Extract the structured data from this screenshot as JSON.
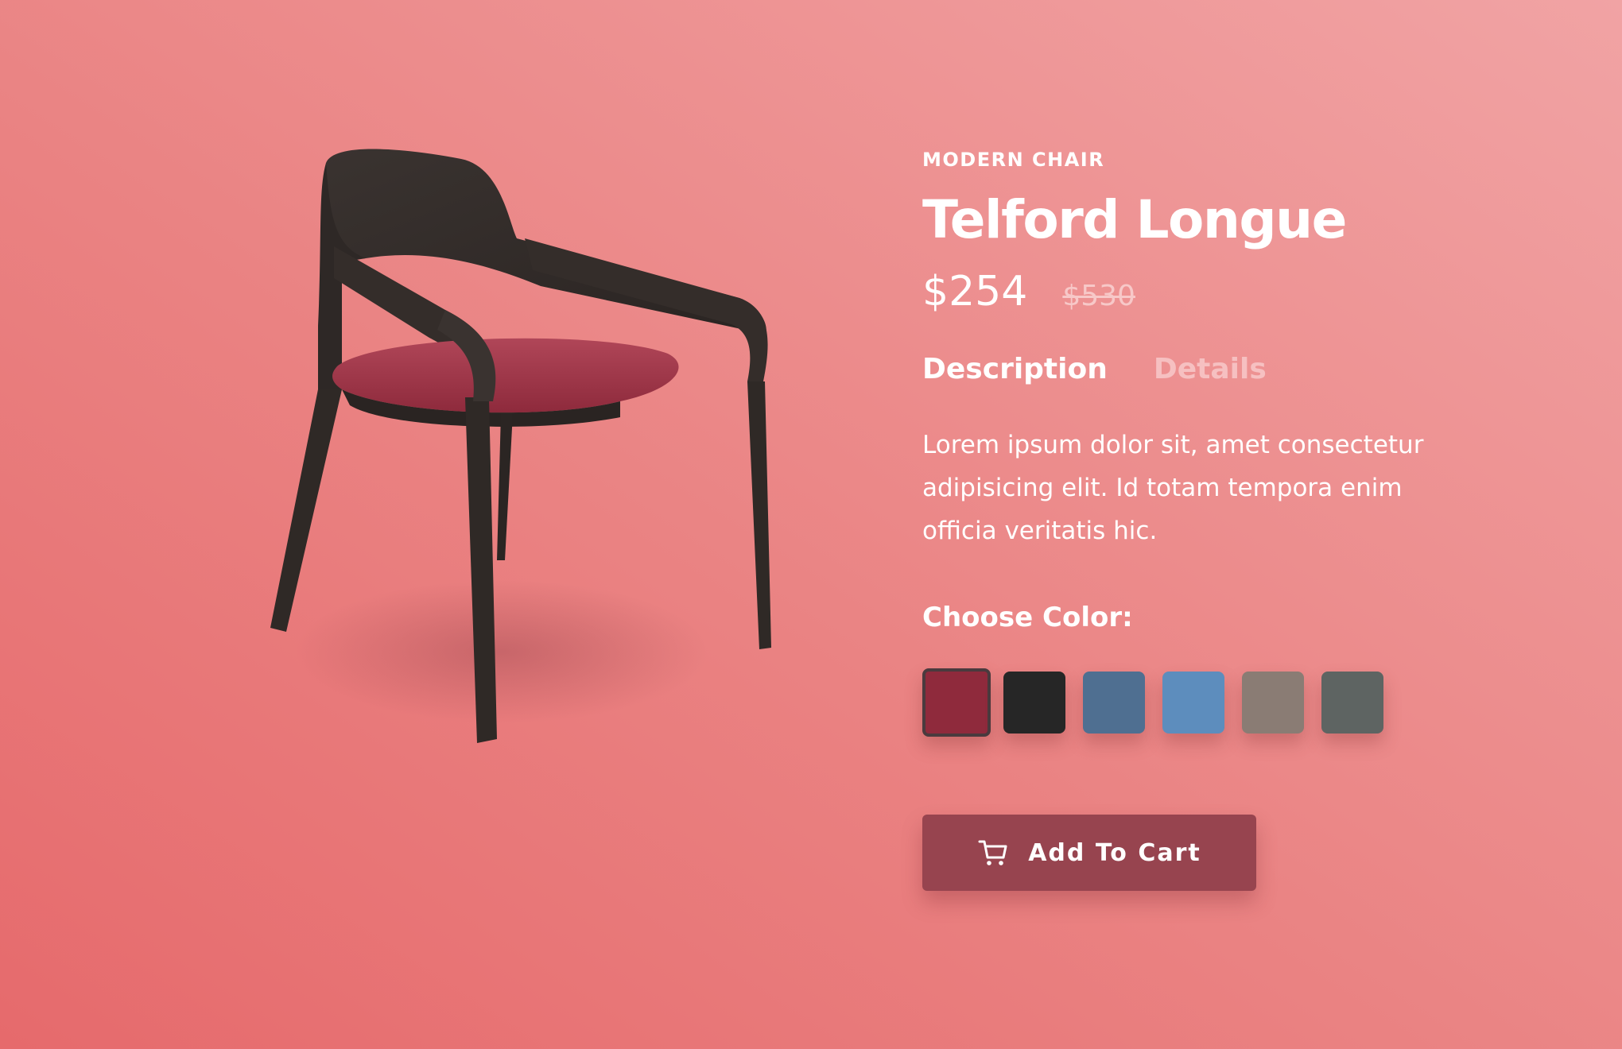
{
  "product": {
    "category": "MODERN CHAIR",
    "title": "Telford Longue",
    "price": "$254",
    "old_price": "$530"
  },
  "tabs": {
    "description_label": "Description",
    "details_label": "Details"
  },
  "description_text": "Lorem ipsum dolor sit, amet consectetur adipisicing elit. Id totam tempora enim officia veritatis hic.",
  "color_picker": {
    "label": "Choose Color:",
    "swatches": [
      {
        "color": "#8f2a3c",
        "selected": true
      },
      {
        "color": "#262626",
        "selected": false
      },
      {
        "color": "#4f6f91",
        "selected": false
      },
      {
        "color": "#5d8dbd",
        "selected": false
      },
      {
        "color": "#8a7c74",
        "selected": false
      },
      {
        "color": "#5e6462",
        "selected": false
      }
    ]
  },
  "cart_button": {
    "label": "Add To Cart",
    "icon": "cart-icon"
  },
  "theme": {
    "background_start": "#e66a6c",
    "background_end": "#f1a3a4",
    "button_color": "#97444f",
    "text_color": "#ffffff"
  }
}
